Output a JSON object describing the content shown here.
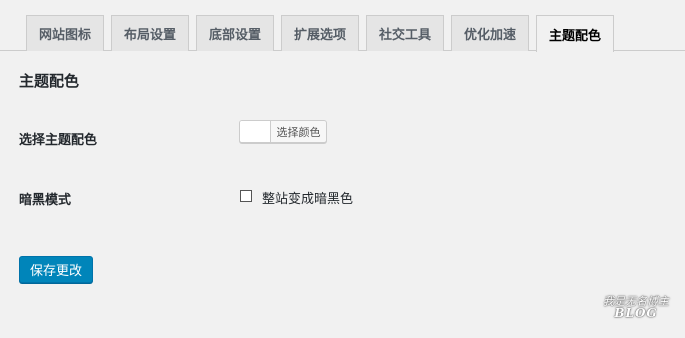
{
  "tabs": [
    {
      "label": "网站图标",
      "active": false
    },
    {
      "label": "布局设置",
      "active": false
    },
    {
      "label": "底部设置",
      "active": false
    },
    {
      "label": "扩展选项",
      "active": false
    },
    {
      "label": "社交工具",
      "active": false
    },
    {
      "label": "优化加速",
      "active": false
    },
    {
      "label": "主题配色",
      "active": true
    }
  ],
  "section": {
    "title": "主题配色"
  },
  "color_row": {
    "label": "选择主题配色",
    "button_label": "选择颜色",
    "current_color": "#ffffff"
  },
  "dark_mode": {
    "label": "暗黑模式",
    "checkbox_label": "整站变成暗黑色",
    "checked": false
  },
  "save_button": {
    "label": "保存更改"
  },
  "watermark": {
    "top": "我是无名博主",
    "bottom": "BLOG"
  },
  "colors": {
    "accent": "#0085ba",
    "background": "#f1f1f1",
    "tab_inactive": "#e5e5e5"
  }
}
